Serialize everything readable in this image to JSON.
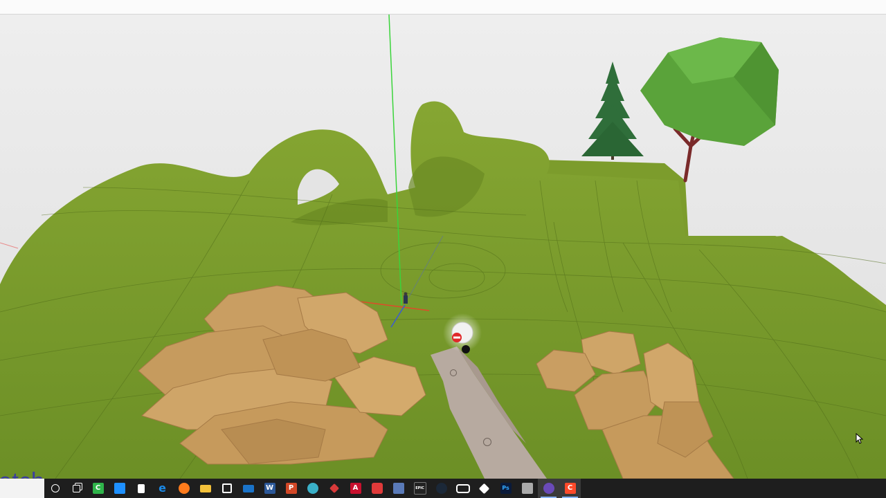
{
  "brand_fragment": "etch",
  "colors": {
    "sky": "#e6e6e6",
    "terrain": "#7a9a2e",
    "terrain_dark": "#5d7a20",
    "rock": "#c9a064",
    "rock_dark": "#9c7440",
    "controller": "#b4a69c",
    "tree_leaves": "#5a9e3a",
    "pine": "#2f6e3a",
    "axis_green": "#3ad43a",
    "axis_red": "#e04a2a",
    "axis_blue": "#3a5ad4",
    "taskbar": "#1e1e1e"
  },
  "taskbar": {
    "items": [
      {
        "name": "cortana-search-icon",
        "icon": "circle",
        "color": "#ffffff"
      },
      {
        "name": "task-view-icon",
        "icon": "task-view",
        "color": "#ffffff"
      },
      {
        "name": "camtasia-icon",
        "icon": "C",
        "color": "#2fb44a"
      },
      {
        "name": "notes-app-icon",
        "icon": "doc",
        "color": "#1e90ff"
      },
      {
        "name": "file-icon",
        "icon": "page",
        "color": "#ffffff"
      },
      {
        "name": "edge-browser-icon",
        "icon": "e",
        "color": "#1b8ae8"
      },
      {
        "name": "firefox-icon",
        "icon": "fox",
        "color": "#ff7b1c"
      },
      {
        "name": "file-explorer-icon",
        "icon": "folder",
        "color": "#f3c13a"
      },
      {
        "name": "store-icon",
        "icon": "store",
        "color": "#ffffff"
      },
      {
        "name": "mail-icon",
        "icon": "mail",
        "color": "#1a73c8"
      },
      {
        "name": "word-icon",
        "icon": "W",
        "color": "#2b5797"
      },
      {
        "name": "powerpoint-icon",
        "icon": "P",
        "color": "#d24726"
      },
      {
        "name": "settings-gear-icon",
        "icon": "gear",
        "color": "#3ab0c8"
      },
      {
        "name": "ruby-app-icon",
        "icon": "ruby",
        "color": "#d93a3a"
      },
      {
        "name": "acrobat-icon",
        "icon": "A",
        "color": "#c8102e"
      },
      {
        "name": "sketchup-icon",
        "icon": "cube",
        "color": "#e03a3a"
      },
      {
        "name": "image-viewer-icon",
        "icon": "img",
        "color": "#5a7ab8"
      },
      {
        "name": "epic-games-icon",
        "icon": "EPIC",
        "color": "#222222"
      },
      {
        "name": "steam-icon",
        "icon": "steam",
        "color": "#1b2838"
      },
      {
        "name": "oculus-icon",
        "icon": "oculus",
        "color": "#ffffff"
      },
      {
        "name": "unity-icon",
        "icon": "unity",
        "color": "#ffffff"
      },
      {
        "name": "photoshop-icon",
        "icon": "Ps",
        "color": "#0a1a3a"
      },
      {
        "name": "gallery-icon",
        "icon": "gallery",
        "color": "#aaaaaa"
      },
      {
        "name": "vr-sketch-icon",
        "icon": "vr",
        "color": "#6a4ab8",
        "active": true
      },
      {
        "name": "gravity-sketch-icon",
        "icon": "C",
        "color": "#ff4a2a",
        "active": true
      }
    ]
  }
}
